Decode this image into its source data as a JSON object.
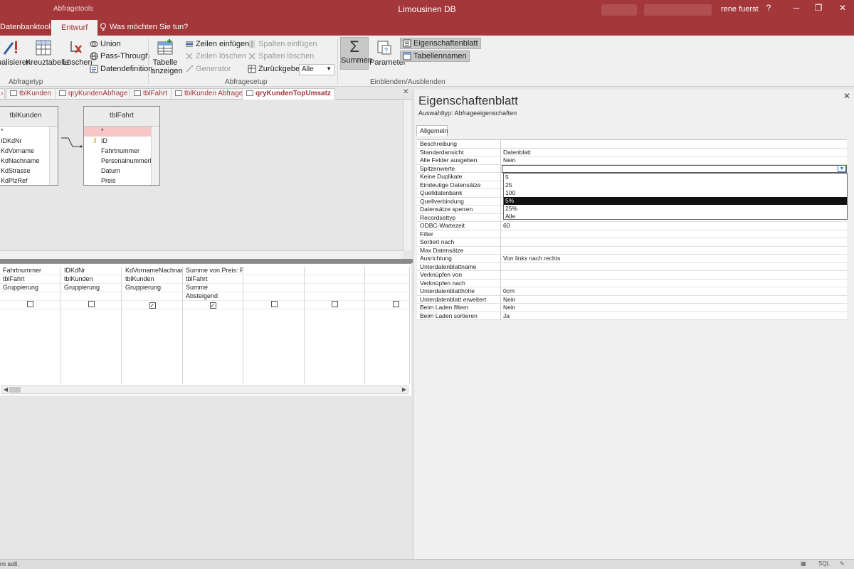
{
  "titlebar": {
    "context_tab": "Abfragetools",
    "title": "Limousinen DB",
    "user": "rene fuerst",
    "help": "?",
    "restore": "❐",
    "close": "✕"
  },
  "ribbon_tabs": {
    "datenbanktools": "Datenbanktools",
    "entwurf": "Entwurf",
    "tell_me": "Was möchten Sie tun?"
  },
  "ribbon": {
    "aktualisieren": "ualisieren",
    "kreuztabelle": "Kreuztabelle",
    "loeschen": "Löschen",
    "union": "Union",
    "pass_through": "Pass-Through",
    "datendefinition": "Datendefinition",
    "group_abfragetyp": "Abfragetyp",
    "tabelle_anzeigen_1": "Tabelle",
    "tabelle_anzeigen_2": "anzeigen",
    "zeilen_einfuegen": "Zeilen einfügen",
    "zeilen_loeschen": "Zeilen löschen",
    "generator": "Generator",
    "spalten_einfuegen": "Spalten einfügen",
    "spalten_loeschen": "Spalten löschen",
    "zurueckgeben": "Zurückgeben:",
    "zurueckgeben_value": "Alle",
    "group_abfragesetup": "Abfragesetup",
    "summen": "Summen",
    "parameter": "Parameter",
    "eigenschaftenblatt": "Eigenschaftenblatt",
    "tabellennamen": "Tabellennamen",
    "group_einblenden": "Einblenden/Ausblenden"
  },
  "doc_tabs": [
    {
      "label": "tblKunden"
    },
    {
      "label": "qryKundenAbfrage"
    },
    {
      "label": "tblFahrt"
    },
    {
      "label": "tblKunden Abfrage"
    },
    {
      "label": "qryKundenTopUmsatz"
    }
  ],
  "tables": {
    "kunden": {
      "title": "tblKunden",
      "fields": [
        "*",
        "IDKdNr",
        "KdVorname",
        "KdNachname",
        "KdStrasse",
        "KdPlzRef"
      ]
    },
    "fahrt": {
      "title": "tblFahrt",
      "fields": [
        "*",
        "ID",
        "Fahrtnummer",
        "PersonalnummerF",
        "Datum",
        "Preis"
      ]
    }
  },
  "qbe_columns": [
    {
      "field": "Fahrtnummer",
      "table": "tblFahrt",
      "total": "Gruppierung",
      "sort": "",
      "show": false
    },
    {
      "field": "IDKdNr",
      "table": "tblKunden",
      "total": "Gruppierung",
      "sort": "",
      "show": false
    },
    {
      "field": "KdVornameNachname",
      "table": "tblKunden",
      "total": "Gruppierung",
      "sort": "",
      "show": true
    },
    {
      "field": "Summe von Preis: Prei",
      "table": "tblFahrt",
      "total": "Summe",
      "sort": "Absteigend",
      "show": true
    },
    {
      "field": "",
      "table": "",
      "total": "",
      "sort": "",
      "show": false
    },
    {
      "field": "",
      "table": "",
      "total": "",
      "sort": "",
      "show": false
    },
    {
      "field": "",
      "table": "",
      "total": "",
      "sort": "",
      "show": false
    }
  ],
  "property_sheet": {
    "title": "Eigenschaftenblatt",
    "subtitle": "Auswahltyp:  Abfrageeigenschaften",
    "tab": "Allgemein",
    "rows": [
      {
        "name": "Beschreibung",
        "value": ""
      },
      {
        "name": "Standardansicht",
        "value": "Datenblatt"
      },
      {
        "name": "Alle Felder ausgeben",
        "value": "Nein"
      },
      {
        "name": "Spitzenwerte",
        "value": ""
      },
      {
        "name": "Keine Duplikate",
        "value": ""
      },
      {
        "name": "Eindeutige Datensätze",
        "value": ""
      },
      {
        "name": "Quelldatenbank",
        "value": ""
      },
      {
        "name": "Quellverbindung",
        "value": ""
      },
      {
        "name": "Datensätze sperren",
        "value": ""
      },
      {
        "name": "Recordsettyp",
        "value": ""
      },
      {
        "name": "ODBC-Wartezeit",
        "value": "60"
      },
      {
        "name": "Filter",
        "value": ""
      },
      {
        "name": "Sortiert nach",
        "value": ""
      },
      {
        "name": "Max Datensätze",
        "value": ""
      },
      {
        "name": "Ausrichtung",
        "value": "Von links nach rechts"
      },
      {
        "name": "Unterdatenblattname",
        "value": ""
      },
      {
        "name": "Verknüpfen von",
        "value": ""
      },
      {
        "name": "Verknüpfen nach",
        "value": ""
      },
      {
        "name": "Unterdatenblatthöhe",
        "value": "0cm"
      },
      {
        "name": "Unterdatenblatt erweitert",
        "value": "Nein"
      },
      {
        "name": "Beim Laden filtern",
        "value": "Nein"
      },
      {
        "name": "Beim Laden sortieren",
        "value": "Ja"
      }
    ],
    "dropdown_options": [
      "5",
      "25",
      "100",
      "5%",
      "25%",
      "Alle"
    ],
    "dropdown_highlight": "5%"
  },
  "status": {
    "text": "rn soll.",
    "sql": "SQL"
  },
  "colors": {
    "accent": "#a4373a",
    "highlight_row": "#f7c7c7"
  }
}
